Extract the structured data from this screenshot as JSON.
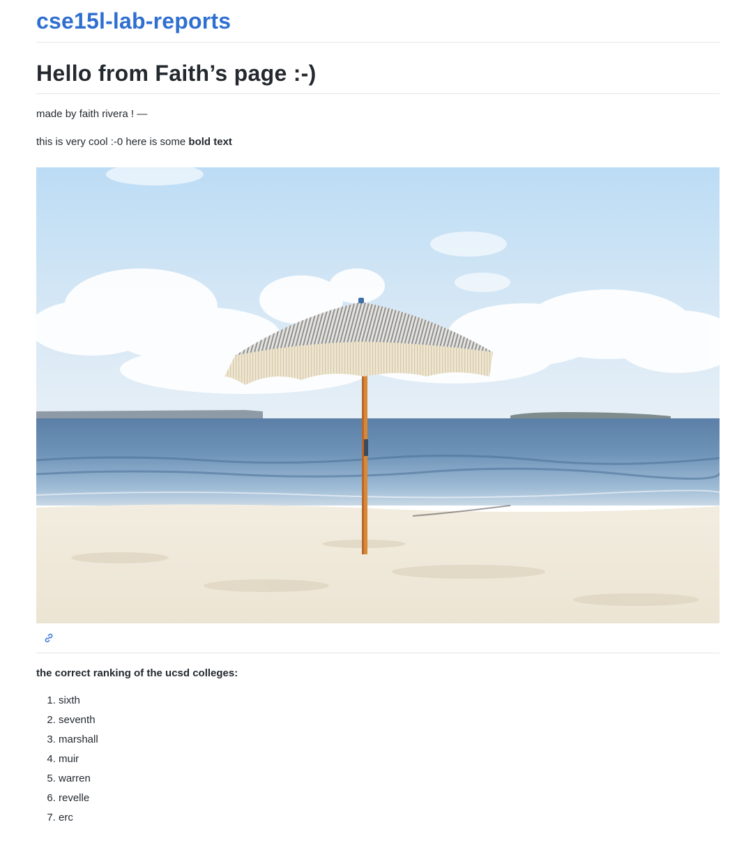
{
  "header": {
    "site_title": "cse15l-lab-reports"
  },
  "page": {
    "heading": "Hello from Faith’s page :-)",
    "line1": "made by faith rivera ! —",
    "line2_prefix": "this is very cool :-0 here is some ",
    "line2_bold": "bold text",
    "photo_description_icon": "link-icon"
  },
  "ranking": {
    "heading": "the correct ranking of the ucsd colleges:",
    "items": [
      "sixth",
      "seventh",
      "marshall",
      "muir",
      "warren",
      "revelle",
      "erc"
    ]
  },
  "colors": {
    "link": "#2f6fd0",
    "text": "#24292f",
    "divider": "#e1e4e8"
  }
}
